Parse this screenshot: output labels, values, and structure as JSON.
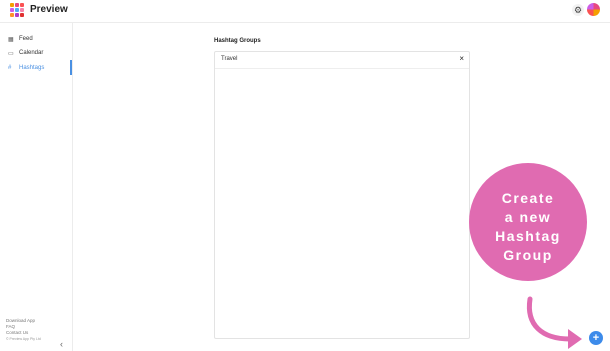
{
  "app": {
    "title": "Preview"
  },
  "colors": {
    "accent": "#4a90e2",
    "callout": "#e06bb1",
    "fab": "#3d8bea"
  },
  "sidebar": {
    "items": [
      {
        "label": "Feed",
        "icon": "grid-icon",
        "glyph": "▦"
      },
      {
        "label": "Calendar",
        "icon": "calendar-icon",
        "glyph": "▭"
      },
      {
        "label": "Hashtags",
        "icon": "hashtag-icon",
        "glyph": "#"
      }
    ],
    "footer": {
      "download": "Download App",
      "faq": "FAQ",
      "contact": "Contact Us",
      "copyright": "© Preview App Pty Ltd"
    }
  },
  "main": {
    "section_title": "Hashtag Groups",
    "group_name": "Travel"
  },
  "callout": {
    "line1": "Create",
    "line2": "a new",
    "line3": "Hashtag",
    "line4": "Group"
  }
}
